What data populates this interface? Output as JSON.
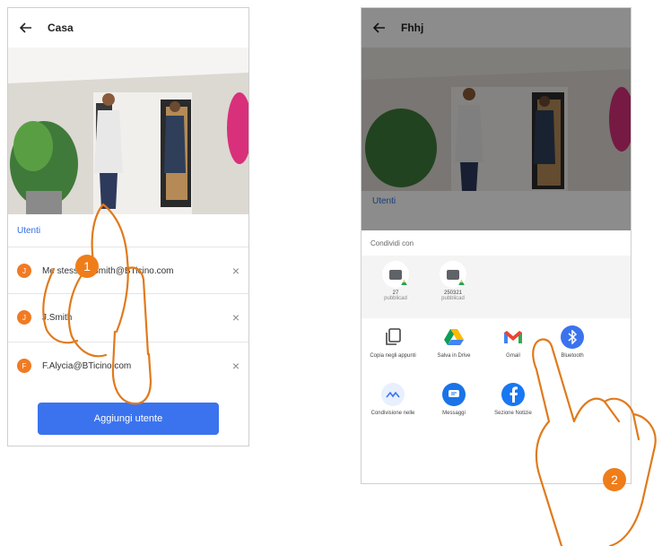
{
  "left_screen": {
    "header": {
      "title": "Casa"
    },
    "section_label": "Utenti",
    "users": [
      {
        "initial": "J",
        "email": "Me stesso J.Smith@BTicino.com"
      },
      {
        "initial": "J",
        "email": "J.Smith"
      },
      {
        "initial": "F",
        "email": "F.Alycia@BTicino.com"
      }
    ],
    "add_button": "Aggiungi utente"
  },
  "right_screen": {
    "header": {
      "title": "Fhhj"
    },
    "section_label": "Utenti",
    "share_sheet": {
      "title": "Condividi con",
      "recent": [
        {
          "line1": "27",
          "line2": "pubblicad"
        },
        {
          "line1": "250321",
          "line2": "pubblicad"
        }
      ],
      "apps": [
        {
          "label": "Copia negli appunti",
          "icon": "copy-icon"
        },
        {
          "label": "Salva in Drive",
          "icon": "drive-icon"
        },
        {
          "label": "Gmail",
          "icon": "gmail-icon"
        },
        {
          "label": "Bluetooth",
          "icon": "bluetooth-icon"
        },
        {
          "label": "Condivisione nelle",
          "icon": "nearby-share-icon"
        },
        {
          "label": "Messaggi",
          "icon": "messages-icon"
        },
        {
          "label": "Sezione Notizie",
          "icon": "facebook-icon"
        }
      ]
    }
  },
  "step_badges": [
    "1",
    "2"
  ],
  "colors": {
    "accent_blue": "#3b73ee",
    "badge_orange": "#ef7d1a",
    "avatar_orange": "#f07b23",
    "hand_outline": "#e07a1c"
  }
}
